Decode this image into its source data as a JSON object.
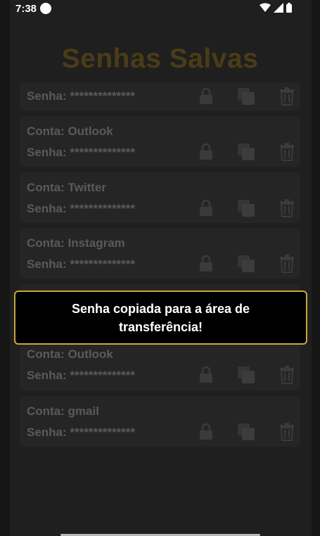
{
  "status": {
    "time": "7:38"
  },
  "header": {
    "title": "Senhas Salvas"
  },
  "cards": [
    {
      "account": "",
      "password": "Senha: **************"
    },
    {
      "account": "Conta: Outlook",
      "password": "Senha: **************"
    },
    {
      "account": "Conta: Twitter",
      "password": "Senha: **************"
    },
    {
      "account": "Conta: Instagram",
      "password": "Senha: **************"
    },
    {
      "account": "Conta: Outlook",
      "password": "Senha: **************"
    },
    {
      "account": "Conta: gmail",
      "password": "Senha: **************"
    }
  ],
  "toast": {
    "message": "Senha copiada para a área de transferência!"
  },
  "icons": {
    "unlock": "lock-icon",
    "copy": "copy-icon",
    "delete": "trash-icon"
  }
}
